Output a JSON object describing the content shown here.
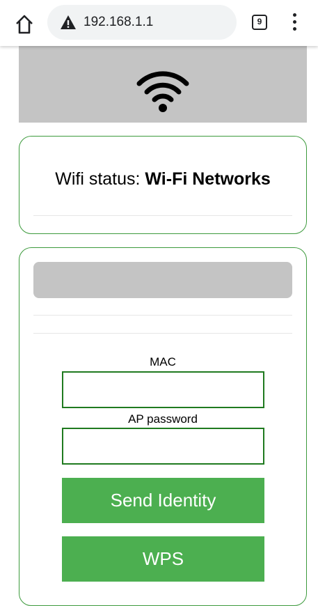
{
  "browser": {
    "url": "192.168.1.1",
    "tab_count": "9",
    "icons": [
      "home-icon",
      "warning-icon",
      "tabs-icon",
      "menu-icon"
    ]
  },
  "banner": {
    "icon": "wifi-icon"
  },
  "status": {
    "label": "Wifi status:",
    "value": "Wi-Fi Networks"
  },
  "form": {
    "mac_label": "MAC",
    "mac_value": "",
    "password_label": "AP password",
    "password_value": "",
    "send_button": "Send Identity",
    "wps_button": "WPS"
  },
  "colors": {
    "accent": "#4caf50",
    "input_border": "#1f7a1f",
    "card_border": "#3c9a3c",
    "banner_bg": "#c4c4c4"
  }
}
